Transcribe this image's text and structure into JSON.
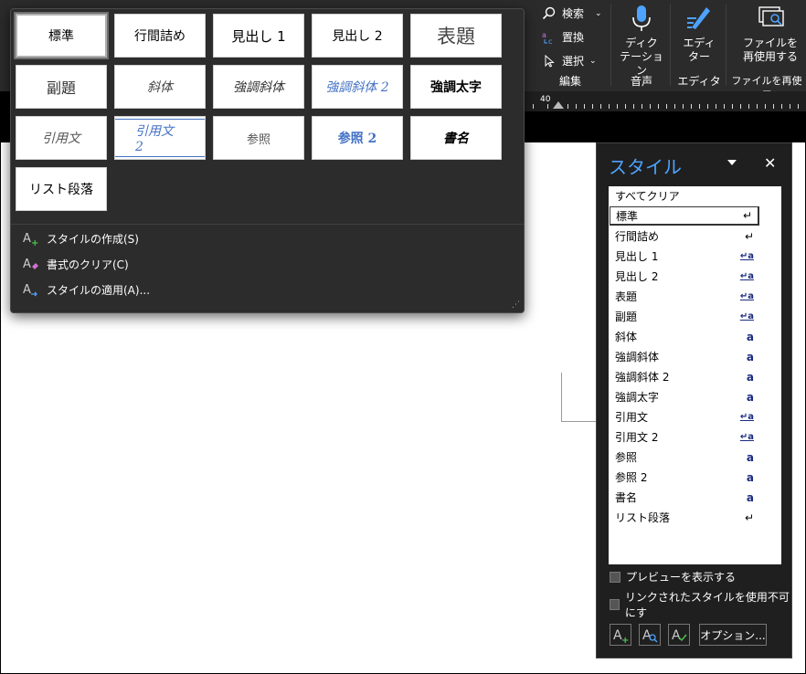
{
  "ribbon": {
    "search_label": "検索",
    "replace_label": "置換",
    "select_label": "選択",
    "edit_group_label": "編集",
    "dictate_label_1": "ディク",
    "dictate_label_2": "テーション",
    "voice_group_label": "音声",
    "editor_label_1": "エディ",
    "editor_label_2": "ター",
    "editor_group_label": "エディター",
    "reuse_label_1": "ファイルを",
    "reuse_label_2": "再使用する",
    "reuse_group_label": "ファイルを再使用"
  },
  "ruler": {
    "number": "40"
  },
  "gallery": {
    "tiles": [
      "標準",
      "行間詰め",
      "見出し 1",
      "見出し 2",
      "表題",
      "副題",
      "斜体",
      "強調斜体",
      "強調斜体 2",
      "強調太字",
      "引用文",
      "引用文 2",
      "参照",
      "参照 2",
      "書名",
      "リスト段落"
    ],
    "menu": [
      {
        "label": "スタイルの作成(S)"
      },
      {
        "label": "書式のクリア(C)"
      },
      {
        "label": "スタイルの適用(A)..."
      }
    ]
  },
  "pane": {
    "title": "スタイル",
    "close": "✕",
    "rows": [
      {
        "name": "すべてクリア",
        "ind": ""
      },
      {
        "name": "標準",
        "ind": "↵"
      },
      {
        "name": "行間詰め",
        "ind": "↵"
      },
      {
        "name": "見出し 1",
        "ind": "↵a"
      },
      {
        "name": "見出し 2",
        "ind": "↵a"
      },
      {
        "name": "表題",
        "ind": "↵a"
      },
      {
        "name": "副題",
        "ind": "↵a"
      },
      {
        "name": "斜体",
        "ind": "a"
      },
      {
        "name": "強調斜体",
        "ind": "a"
      },
      {
        "name": "強調斜体 2",
        "ind": "a"
      },
      {
        "name": "強調太字",
        "ind": "a"
      },
      {
        "name": "引用文",
        "ind": "↵a"
      },
      {
        "name": "引用文 2",
        "ind": "↵a"
      },
      {
        "name": "参照",
        "ind": "a"
      },
      {
        "name": "参照 2",
        "ind": "a"
      },
      {
        "name": "書名",
        "ind": "a"
      },
      {
        "name": "リスト段落",
        "ind": "↵"
      }
    ],
    "preview_label": "プレビューを表示する",
    "linked_label": "リンクされたスタイルを使用不可にす",
    "options_label": "オプション..."
  }
}
